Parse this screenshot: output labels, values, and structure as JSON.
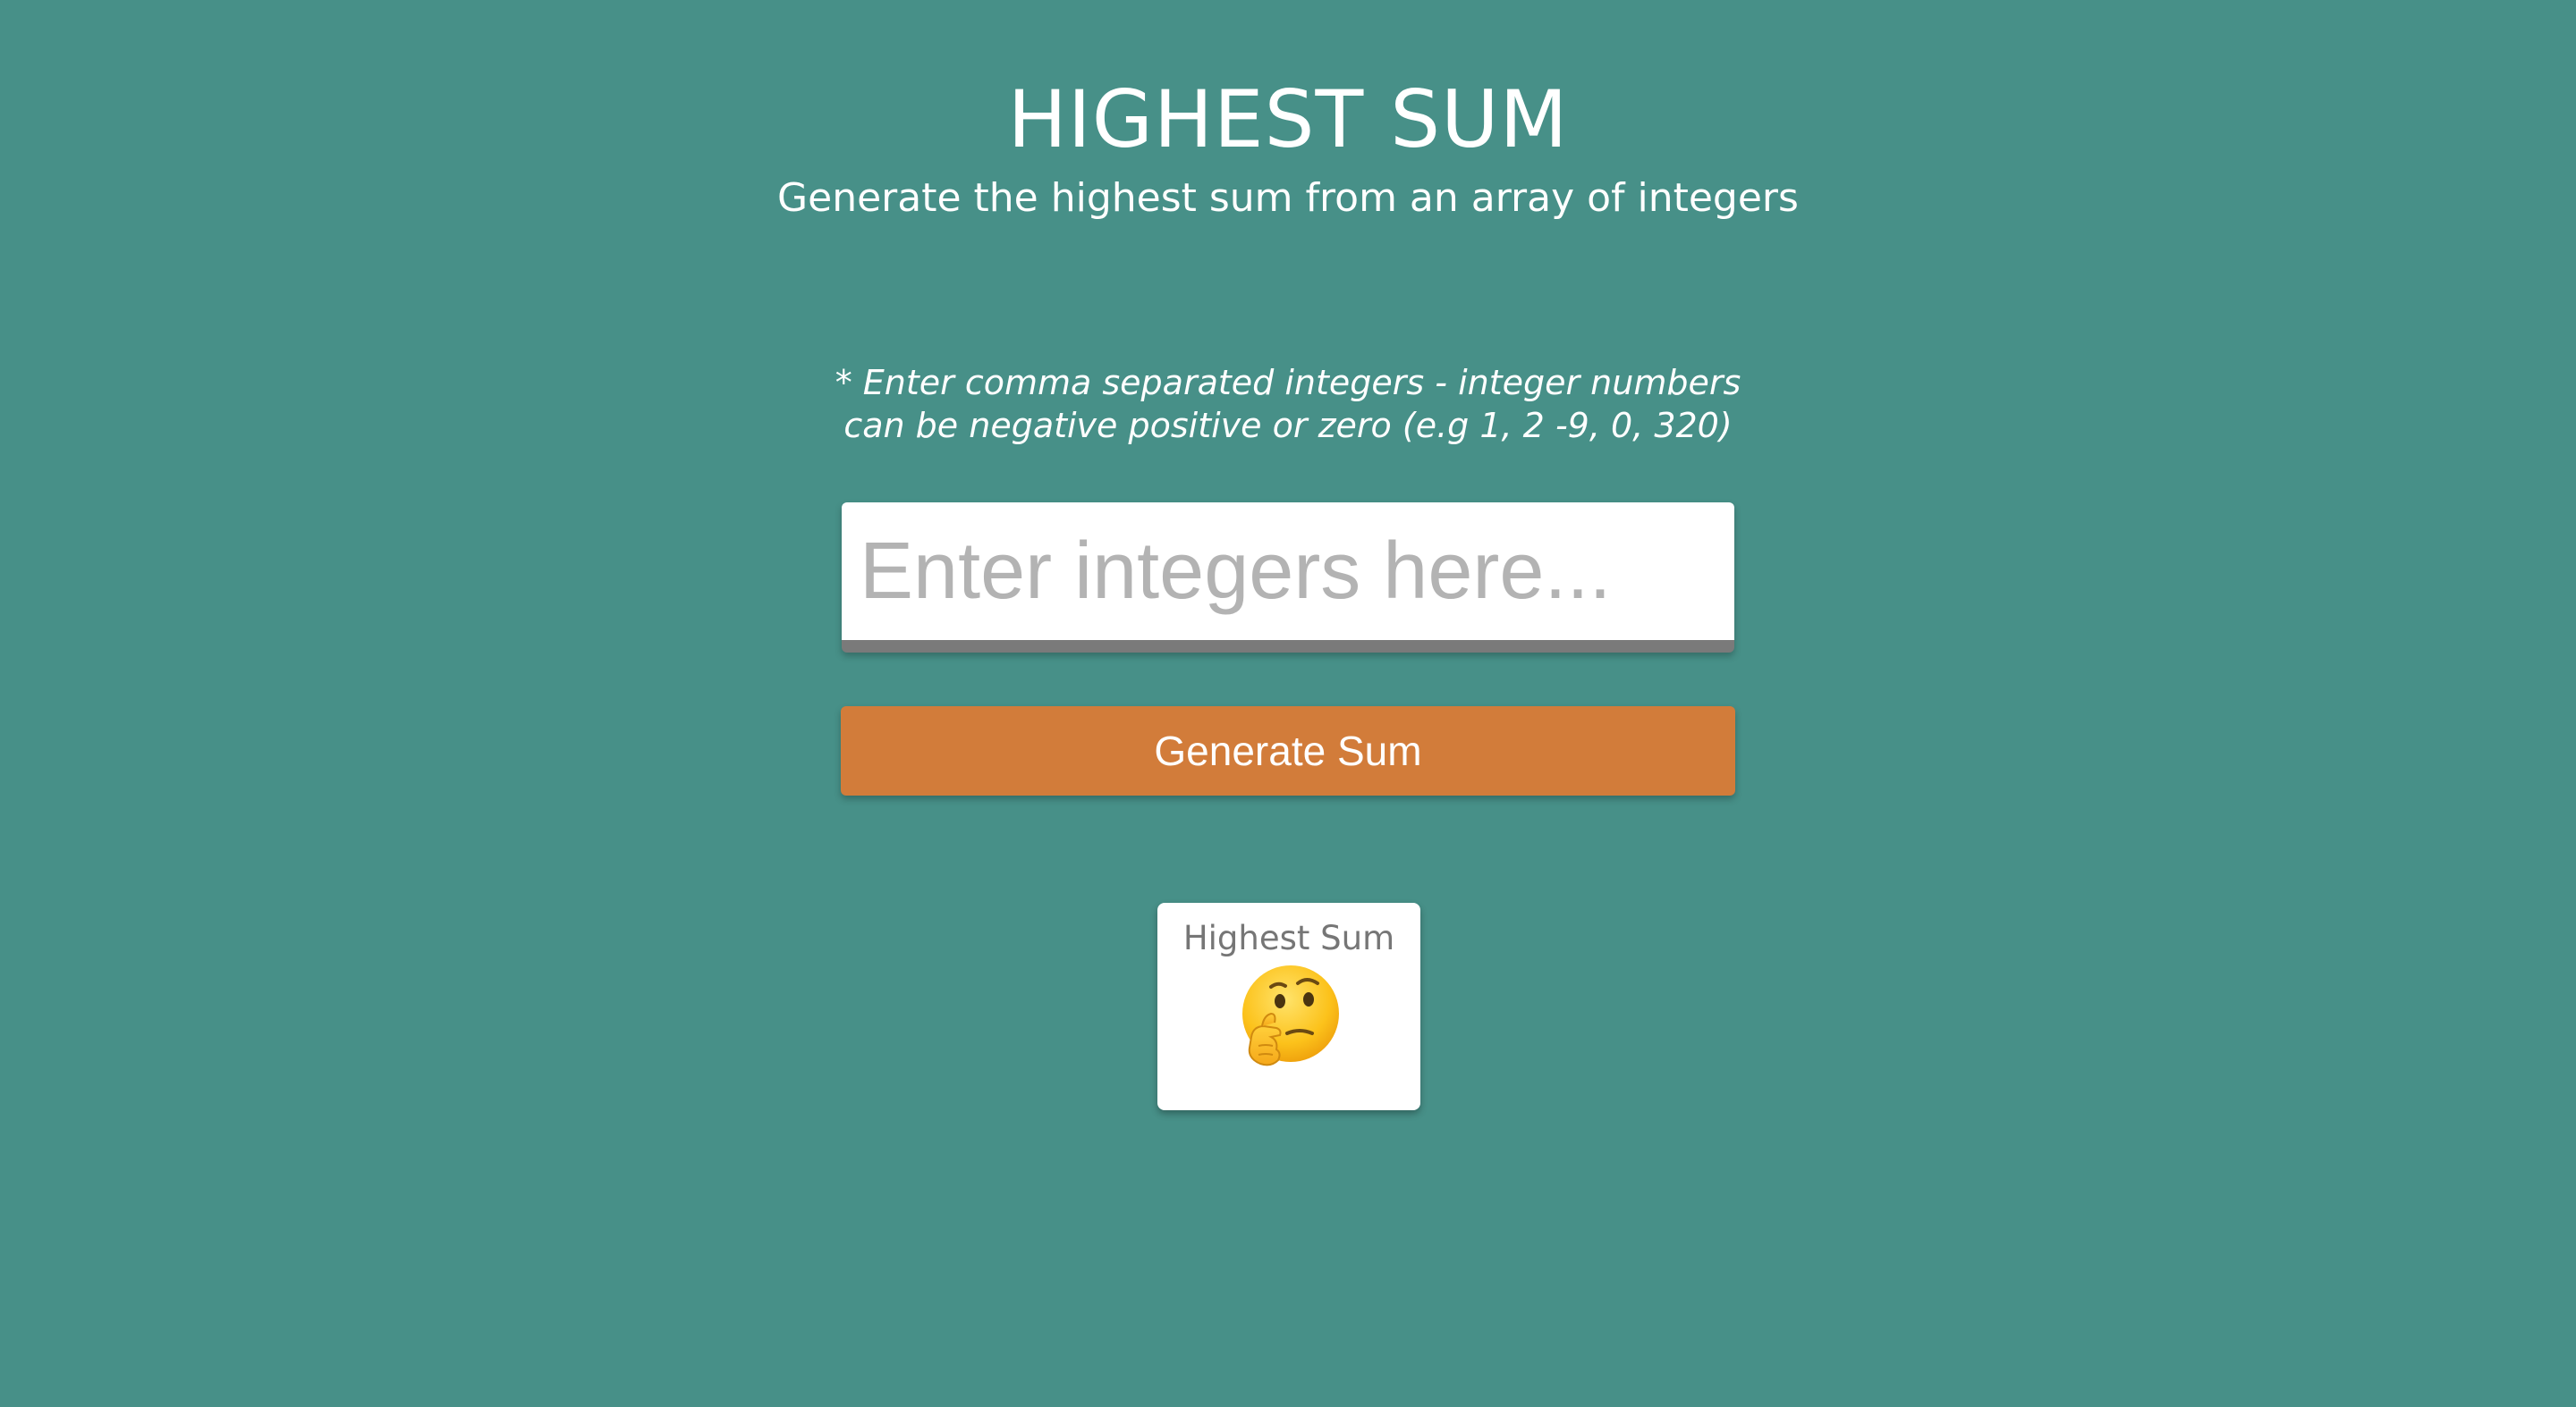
{
  "header": {
    "title": "HIGHEST SUM",
    "subtitle": "Generate the highest sum from an array of integers"
  },
  "instructions": {
    "line1": "* Enter comma separated integers - integer numbers",
    "line2": "can be negative positive or zero (e.g 1, 2 -9, 0, 320)"
  },
  "input": {
    "value": "",
    "placeholder": "Enter integers here..."
  },
  "button": {
    "label": "Generate Sum"
  },
  "result": {
    "label": "Highest Sum",
    "icon": "thinking-face-icon"
  },
  "colors": {
    "background": "#479088",
    "button": "#d27c3a",
    "card": "#ffffff"
  }
}
